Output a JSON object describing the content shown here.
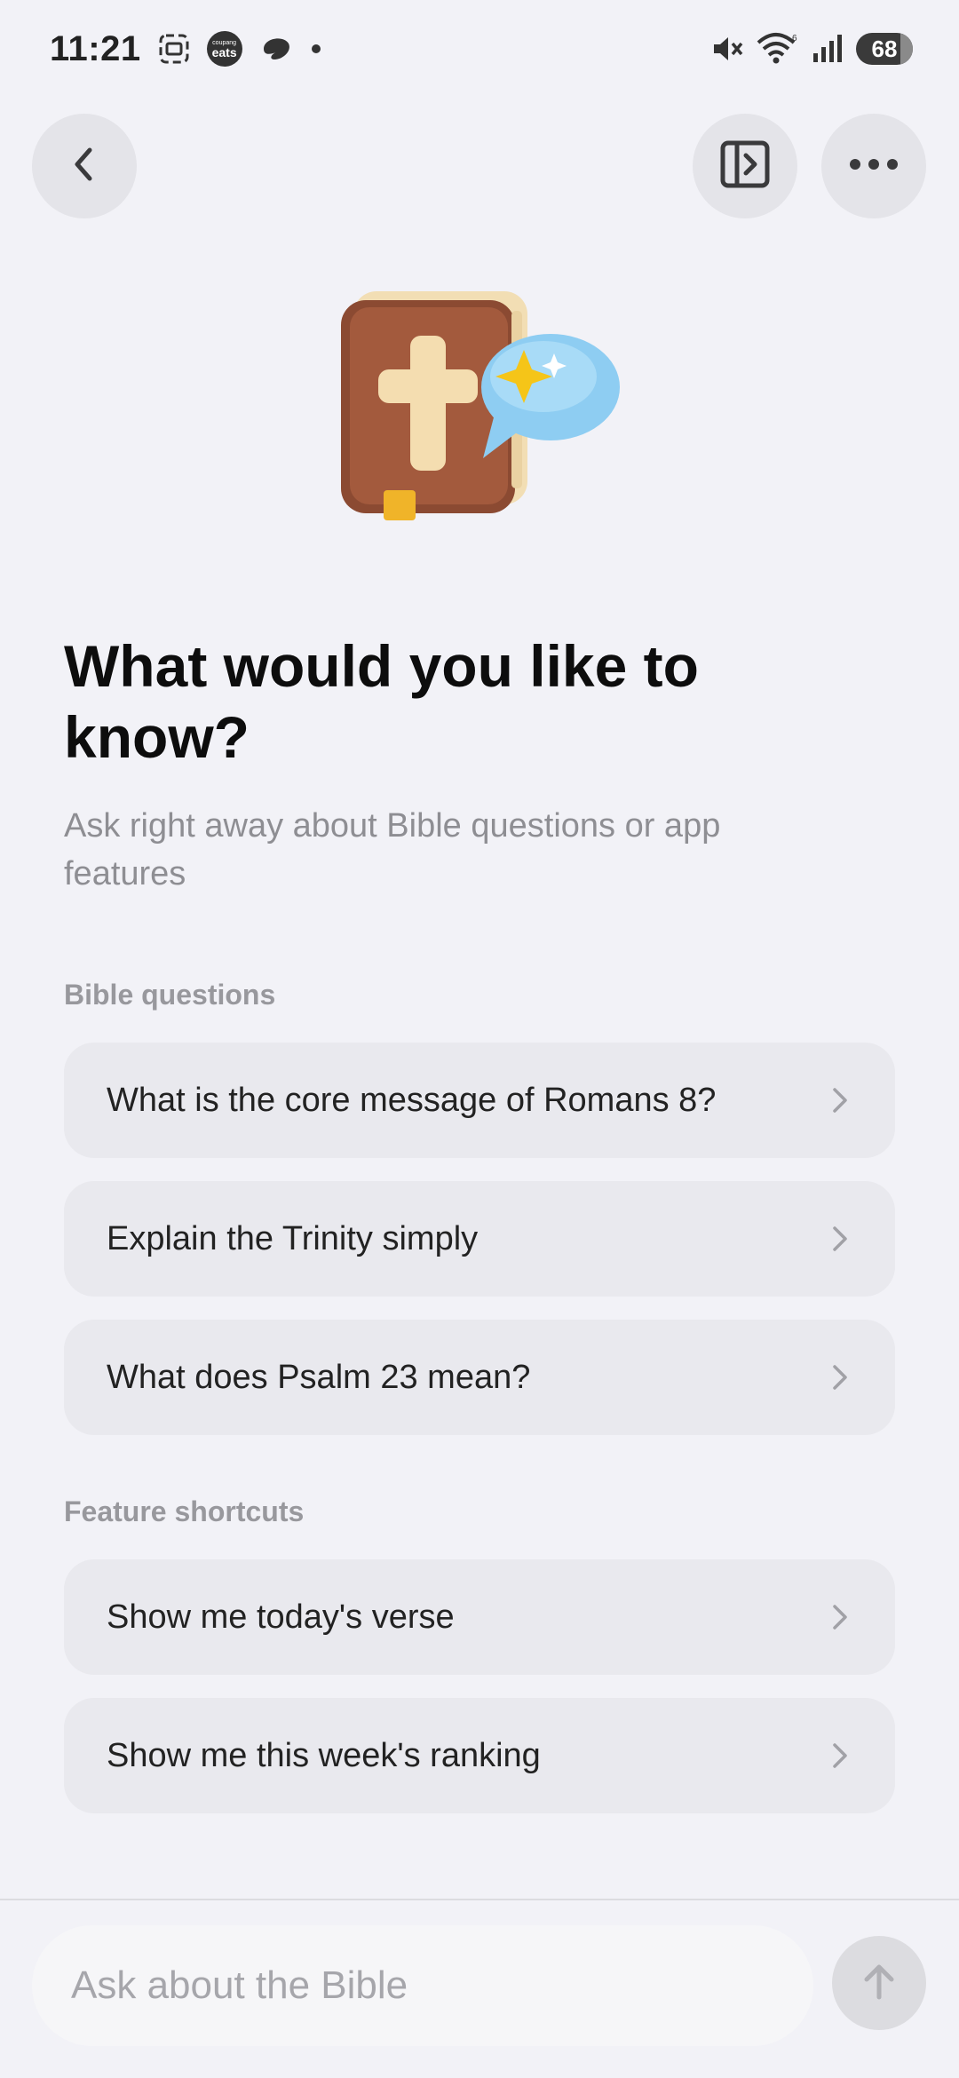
{
  "status_bar": {
    "time": "11:21",
    "app_badge_label": "eats",
    "app_badge_caption": "coupang",
    "battery_level": "68"
  },
  "header": {
    "back_icon": "chevron-left-icon",
    "panel_icon": "sidebar-toggle-icon",
    "more_icon": "ellipsis-icon"
  },
  "hero": {
    "icon": "bible-chat-illustration"
  },
  "intro": {
    "title": "What would you like to know?",
    "subtitle": "Ask right away about Bible questions or app features"
  },
  "sections": {
    "bible_questions": {
      "label": "Bible questions",
      "items": [
        "What is the core message of Romans 8?",
        "Explain the Trinity simply",
        "What does Psalm 23 mean?"
      ]
    },
    "feature_shortcuts": {
      "label": "Feature shortcuts",
      "items": [
        "Show me today's verse",
        "Show me this week's ranking"
      ]
    }
  },
  "composer": {
    "placeholder": "Ask about the Bible",
    "value": "",
    "send_icon": "arrow-up-icon"
  },
  "colors": {
    "background": "#f2f2f7",
    "card": "#e9e9ee",
    "book_brown": "#8b4a32",
    "bubble_blue": "#8ecdf2",
    "star_yellow": "#f5c518"
  }
}
